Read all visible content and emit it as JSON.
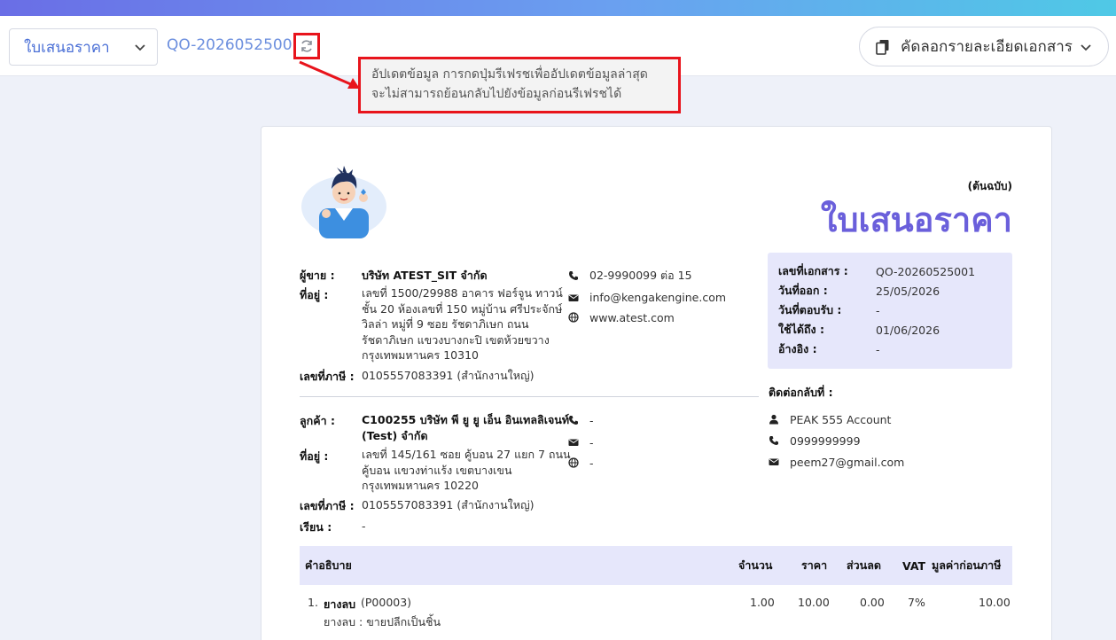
{
  "header": {
    "doc_type_select": "ใบเสนอราคา",
    "doc_number": "QO-20260525001",
    "copy_button": "คัดลอกรายละเอียดเอกสาร"
  },
  "tooltip": {
    "line1": "อัปเดตข้อมูล การกดปุ่มรีเฟรชเพื่ออัปเดตข้อมูลล่าสุด",
    "line2": "จะไม่สามารถย้อนกลับไปยังข้อมูลก่อนรีเฟรชได้"
  },
  "document": {
    "original_tag": "(ต้นฉบับ)",
    "title": "ใบเสนอราคา",
    "seller": {
      "label": "ผู้ขาย :",
      "name": "บริษัท ATEST_SIT จำกัด",
      "address_label": "ที่อยู่ :",
      "address_lines": [
        "เลขที่ 1500/29988 อาคาร ฟอร์จูน ทาวน์",
        "ชั้น 20 ห้องเลขที่ 150 หมู่บ้าน ศรีประจักษ์",
        "วิลล่า หมู่ที่ 9 ซอย รัชดาภิเษก ถนน",
        "รัชดาภิเษก แขวงบางกะปิ เขตห้วยขวาง",
        "กรุงเทพมหานคร 10310"
      ],
      "tax_label": "เลขที่ภาษี :",
      "tax_id": "0105557083391 (สำนักงานใหญ่)",
      "phone": "02-9990099 ต่อ 15",
      "email": "info@kengakengine.com",
      "website": "www.atest.com"
    },
    "customer": {
      "label": "ลูกค้า :",
      "name_line1": "C100255 บริษัท พี ยู ยู เอ็น อินเทลลิเจนท์",
      "name_line2": "(Test) จำกัด",
      "address_label": "ที่อยู่ :",
      "address_lines": [
        "เลขที่ 145/161 ซอย คู้บอน 27 แยก 7 ถนน",
        "คู้บอน  แขวงท่าแร้ง เขตบางเขน",
        "กรุงเทพมหานคร 10220"
      ],
      "tax_label": "เลขที่ภาษี :",
      "tax_id": "0105557083391 (สำนักงานใหญ่)",
      "attn_label": "เรียน :",
      "attn": "-",
      "phone": "-",
      "email": "-",
      "website": "-"
    },
    "meta": {
      "doc_no_label": "เลขที่เอกสาร :",
      "doc_no": "QO-20260525001",
      "issue_label": "วันที่ออก :",
      "issue": "25/05/2026",
      "accept_label": "วันที่ตอบรับ :",
      "accept": "-",
      "valid_label": "ใช้ได้ถึง :",
      "valid": "01/06/2026",
      "ref_label": "อ้างอิง :",
      "ref": "-"
    },
    "contact_back": {
      "label": "ติดต่อกลับที่ :",
      "person": "PEAK 555 Account",
      "phone": "0999999999",
      "email": "peem27@gmail.com"
    },
    "table": {
      "headers": {
        "desc": "คำอธิบาย",
        "qty": "จำนวน",
        "price": "ราคา",
        "discount": "ส่วนลด",
        "vat": "VAT",
        "pretax": "มูลค่าก่อนภาษี"
      },
      "rows": [
        {
          "no": "1.",
          "name": "ยางลบ",
          "code": "(P00003)",
          "sub": "ยางลบ : ขายปลีกเป็นชิ้น",
          "qty": "1.00",
          "price": "10.00",
          "discount": "0.00",
          "vat": "7%",
          "pretax": "10.00"
        }
      ]
    }
  },
  "colors": {
    "accent": "#6a5fdb",
    "link": "#4a6fd6",
    "highlight_border": "#e8141c",
    "meta_bg": "#e6e7fb"
  }
}
